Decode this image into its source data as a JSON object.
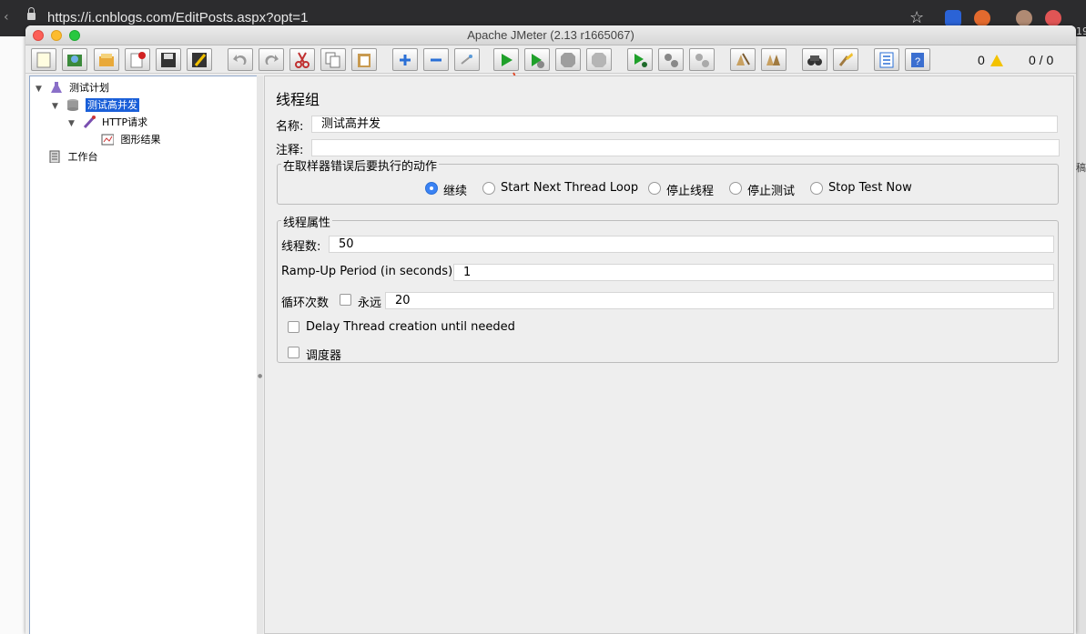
{
  "browser": {
    "url": "https://i.cnblogs.com/EditPosts.aspx?opt=1",
    "edge_text": "19",
    "edge_text2": "稿"
  },
  "app": {
    "title": "Apache JMeter (2.13 r1665067)"
  },
  "toolbar": {
    "warning_count": "0",
    "thread_count": "0 / 0",
    "buttons": [
      "new-icon",
      "templates-icon",
      "open-icon",
      "close-icon",
      "save-icon",
      "save-as-icon",
      "undo-icon",
      "redo-icon",
      "cut-icon",
      "copy-icon",
      "paste-icon",
      "expand-icon",
      "collapse-icon",
      "toggle-icon",
      "start-icon",
      "start-no-pause-icon",
      "stop-icon",
      "shutdown-icon",
      "remote-start-icon",
      "remote-stop-icon",
      "remote-shutdown-icon",
      "clear-icon",
      "clear-all-icon",
      "search-icon",
      "reset-search-icon",
      "function-helper-icon",
      "help-icon"
    ]
  },
  "tree": {
    "items": [
      {
        "label": "测试计划",
        "icon": "test-plan-icon"
      },
      {
        "label": "测试高并发",
        "icon": "thread-group-icon",
        "selected": true
      },
      {
        "label": "HTTP请求",
        "icon": "http-sampler-icon"
      },
      {
        "label": "图形结果",
        "icon": "graph-results-icon"
      },
      {
        "label": "工作台",
        "icon": "workbench-icon"
      }
    ]
  },
  "main": {
    "title": "线程组",
    "name_label": "名称:",
    "name_value": "测试高并发",
    "comment_label": "注释:",
    "comment_value": "",
    "error_group": {
      "legend": "在取样器错误后要执行的动作",
      "options": [
        "继续",
        "Start Next Thread Loop",
        "停止线程",
        "停止测试",
        "Stop Test Now"
      ],
      "selected": "继续"
    },
    "thread_group": {
      "legend": "线程属性",
      "threads_label": "线程数:",
      "threads_value": "50",
      "rampup_label": "Ramp-Up Period (in seconds):",
      "rampup_value": "1",
      "loop_label": "循环次数",
      "forever_label": "永远",
      "loop_value": "20",
      "delay_label": "Delay Thread creation until needed",
      "scheduler_label": "调度器"
    }
  },
  "colors": {
    "selection": "#1a5fd8",
    "annotation": "#e0492a",
    "radio_on": "#3a82f4"
  }
}
